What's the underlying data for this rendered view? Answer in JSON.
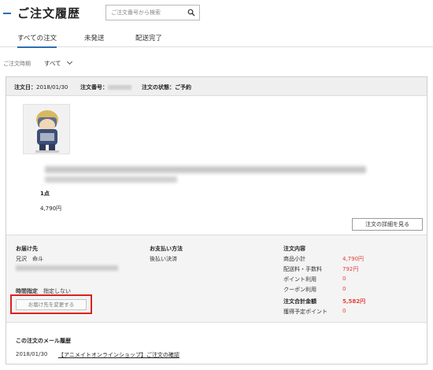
{
  "header": {
    "title": "ご注文履歴",
    "search_placeholder": "ご注文番号から検索"
  },
  "tabs": [
    {
      "label": "すべての注文",
      "active": true
    },
    {
      "label": "未発送",
      "active": false
    },
    {
      "label": "配送完了",
      "active": false
    }
  ],
  "filter": {
    "label": "ご注文時期",
    "selected": "すべて"
  },
  "order": {
    "date_label": "注文日：",
    "date_value": "2018/01/30",
    "number_label": "注文番号：",
    "status_label": "注文の状態：",
    "status_value": "ご予約",
    "quantity": "1点",
    "price": "4,790円",
    "detail_button": "注文の詳細を見る"
  },
  "delivery": {
    "title": "お届け先",
    "name": "兄沢　命斗",
    "time_label": "時間指定",
    "time_value": "指定しない",
    "change_button": "お届け先を変更する"
  },
  "payment": {
    "title": "お支払い方法",
    "method": "後払い決済"
  },
  "summary": {
    "title": "注文内容",
    "rows": [
      {
        "label": "商品小計",
        "value": "4,790円"
      },
      {
        "label": "配送料・手数料",
        "value": "792円"
      },
      {
        "label": "ポイント利用",
        "value": "0"
      },
      {
        "label": "クーポン利用",
        "value": "0"
      },
      {
        "label": "注文合計金額",
        "value": "5,582円"
      },
      {
        "label": "獲得予定ポイント",
        "value": "0"
      }
    ]
  },
  "mail_history": {
    "title": "この注文のメール履歴",
    "date": "2018/01/30",
    "subject": "【アニメイトオンラインショップ】ご注文の確認"
  },
  "colors": {
    "accent": "#2d6fb3",
    "price_red": "#e2413a",
    "highlight_red": "#d9231f"
  }
}
